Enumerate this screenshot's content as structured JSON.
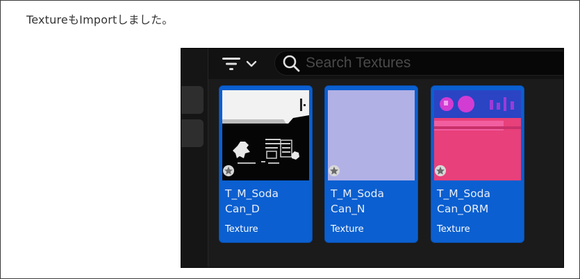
{
  "caption": "TextureもImportしました。",
  "toolbar": {
    "filter_icon": "filter-lines-icon",
    "dropdown_icon": "chevron-down-icon",
    "search_icon": "search-icon",
    "search_placeholder": "Search Textures"
  },
  "assets": [
    {
      "name_line1": "T_M_Soda",
      "name_line2": "Can_D",
      "type": "Texture"
    },
    {
      "name_line1": "T_M_Soda",
      "name_line2": "Can_N",
      "type": "Texture"
    },
    {
      "name_line1": "T_M_Soda",
      "name_line2": "Can_ORM",
      "type": "Texture"
    }
  ],
  "colors": {
    "tile_bg": "#0b5fd0",
    "normal_map": "#b1b1e6",
    "orm_blue": "#2a44c4",
    "orm_pink": "#e8407a",
    "panel_bg": "#1b1b1b"
  }
}
